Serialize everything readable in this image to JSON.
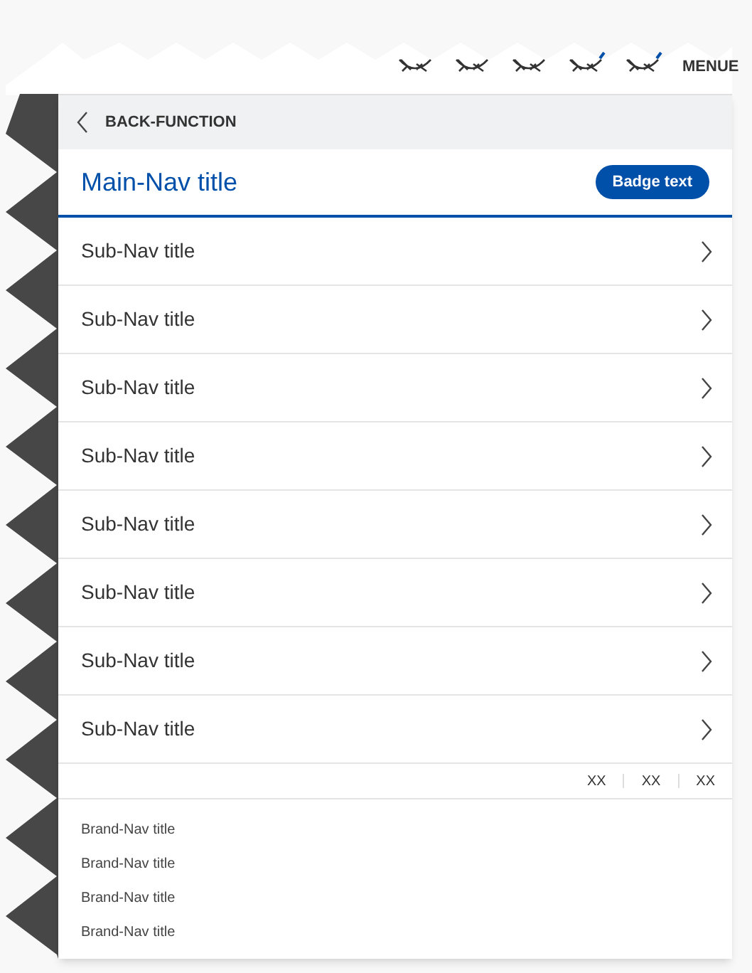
{
  "header": {
    "menu_label": "MENUE"
  },
  "back": {
    "label": "BACK-FUNCTION"
  },
  "main_nav": {
    "title": "Main-Nav title",
    "badge": "Badge text"
  },
  "sub_nav": [
    {
      "title": "Sub-Nav title"
    },
    {
      "title": "Sub-Nav title"
    },
    {
      "title": "Sub-Nav title"
    },
    {
      "title": "Sub-Nav title"
    },
    {
      "title": "Sub-Nav title"
    },
    {
      "title": "Sub-Nav title"
    },
    {
      "title": "Sub-Nav title"
    },
    {
      "title": "Sub-Nav title"
    }
  ],
  "meta_links": [
    "XX",
    "XX",
    "XX"
  ],
  "brand_nav": [
    "Brand-Nav title",
    "Brand-Nav title",
    "Brand-Nav title",
    "Brand-Nav title"
  ]
}
